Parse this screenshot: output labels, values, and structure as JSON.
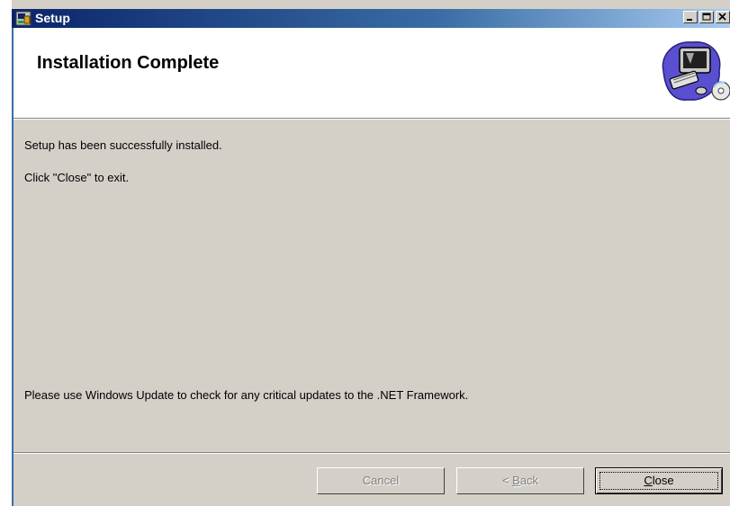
{
  "window": {
    "title": "Setup",
    "controls": [
      "minimize",
      "maximize",
      "close"
    ]
  },
  "header": {
    "title": "Installation Complete",
    "art_icon": "computer-cd-icon"
  },
  "body": {
    "line1": "Setup has been successfully installed.",
    "line2": "Click \"Close\" to exit.",
    "line3": "Please use Windows Update to check for any critical updates to the .NET Framework."
  },
  "buttons": {
    "cancel": {
      "label": "Cancel",
      "enabled": false
    },
    "back": {
      "label_pre": "< ",
      "label_mnemonic": "B",
      "label_post": "ack",
      "enabled": false
    },
    "close": {
      "label_mnemonic": "C",
      "label_post": "lose",
      "enabled": true,
      "default": true
    }
  },
  "colors": {
    "titlebar_start": "#0a246a",
    "titlebar_end": "#a6caf0",
    "dialog_face": "#d4d0c8"
  }
}
